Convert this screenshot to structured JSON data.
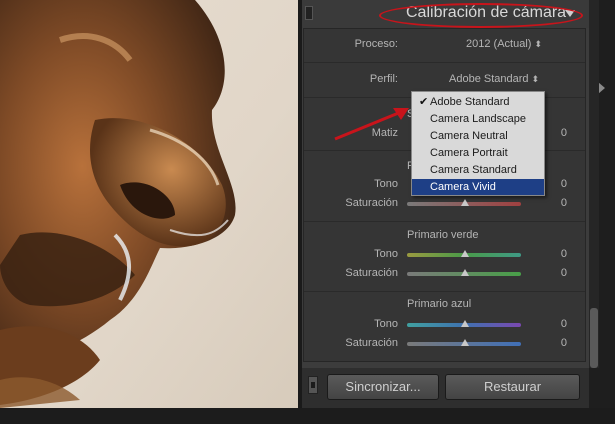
{
  "panel": {
    "title": "Calibración de cámara"
  },
  "process": {
    "label": "Proceso:",
    "value": "2012 (Actual)"
  },
  "profile": {
    "label": "Perfil:",
    "value": "Adobe Standard"
  },
  "profile_menu": {
    "options": [
      "Adobe Standard",
      "Camera Landscape",
      "Camera Neutral",
      "Camera Portrait",
      "Camera Standard",
      "Camera Vivid"
    ],
    "checked": "Adobe Standard",
    "highlighted": "Camera Vivid"
  },
  "partial_labels": {
    "shadow_initial": "S",
    "red_initial": "P"
  },
  "shadows": {
    "hue_label": "Matiz",
    "hue_value": "0"
  },
  "red_primary": {
    "hue_label": "Tono",
    "hue_value": "0",
    "sat_label": "Saturación",
    "sat_value": "0"
  },
  "green_primary": {
    "title": "Primario verde",
    "hue_label": "Tono",
    "hue_value": "0",
    "sat_label": "Saturación",
    "sat_value": "0"
  },
  "blue_primary": {
    "title": "Primario azul",
    "hue_label": "Tono",
    "hue_value": "0",
    "sat_label": "Saturación",
    "sat_value": "0"
  },
  "buttons": {
    "sync": "Sincronizar...",
    "reset": "Restaurar"
  },
  "colors": {
    "annotation_red": "#c8141b",
    "menu_highlight": "#1e3f86"
  }
}
